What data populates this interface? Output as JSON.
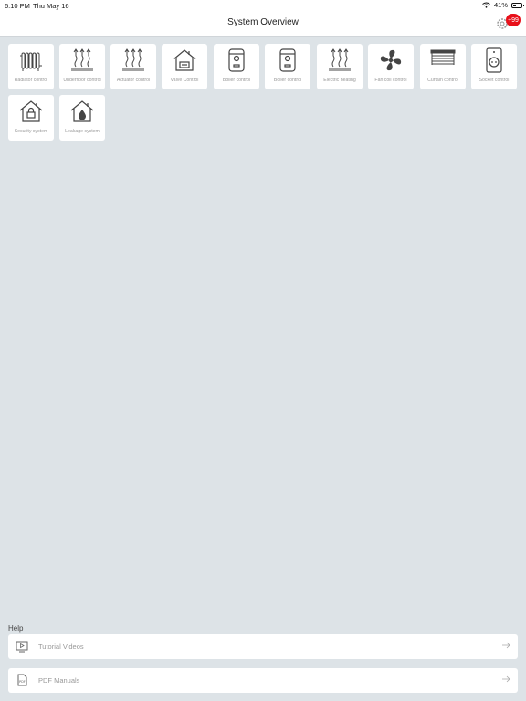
{
  "status_bar": {
    "time": "6:10 PM",
    "date": "Thu May 16",
    "battery": "41%",
    "battery_level": 0.41
  },
  "nav": {
    "title": "System Overview",
    "badge": "+99",
    "settings_icon": "gear-icon"
  },
  "tiles": [
    {
      "label": "Radiator control",
      "icon": "radiator-icon"
    },
    {
      "label": "Underfloor control",
      "icon": "underfloor-heating-icon"
    },
    {
      "label": "Actuator control",
      "icon": "actuator-icon"
    },
    {
      "label": "Valve Control",
      "icon": "house-valve-icon"
    },
    {
      "label": "Boiler control",
      "icon": "boiler-icon"
    },
    {
      "label": "Boiler control",
      "icon": "boiler-icon"
    },
    {
      "label": "Electric heating",
      "icon": "electric-heating-icon"
    },
    {
      "label": "Fan coil control",
      "icon": "fan-icon"
    },
    {
      "label": "Curtain control",
      "icon": "curtain-icon"
    },
    {
      "label": "Socket control",
      "icon": "socket-icon"
    },
    {
      "label": "Security system",
      "icon": "house-lock-icon"
    },
    {
      "label": "Leakage system",
      "icon": "house-drop-icon"
    }
  ],
  "help": {
    "title": "Help",
    "items": [
      {
        "label": "Tutorial Videos",
        "icon": "video-icon"
      },
      {
        "label": "PDF Manuals",
        "icon": "pdf-icon"
      }
    ]
  },
  "colors": {
    "background": "#dde3e7",
    "badge": "#e8101a",
    "icon": "#444444"
  }
}
